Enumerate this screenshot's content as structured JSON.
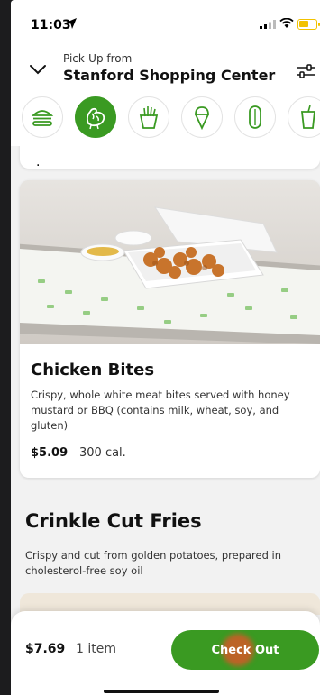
{
  "status": {
    "time": "11:03"
  },
  "header": {
    "pickup_label": "Pick-Up from",
    "store_name": "Stanford Shopping Center"
  },
  "categories": [
    {
      "icon": "burger-icon",
      "active": false
    },
    {
      "icon": "chicken-icon",
      "active": true
    },
    {
      "icon": "fries-icon",
      "active": false
    },
    {
      "icon": "ice-cream-icon",
      "active": false
    },
    {
      "icon": "pickle-icon",
      "active": false
    },
    {
      "icon": "drink-icon",
      "active": false
    }
  ],
  "menu": {
    "item": {
      "name": "Chicken Bites",
      "description": "Crispy, whole white meat bites served with honey mustard or BBQ (contains milk, wheat, soy, and gluten)",
      "price": "$5.09",
      "calories": "300 cal."
    },
    "section": {
      "title": "Crinkle Cut Fries",
      "description": "Crispy and cut from golden potatoes, prepared in cholesterol-free soy oil"
    }
  },
  "checkout": {
    "total": "$7.69",
    "item_count": "1 item",
    "button_label": "Check Out"
  },
  "colors": {
    "brand_green": "#3a9a22",
    "background": "#f2f2f2"
  }
}
